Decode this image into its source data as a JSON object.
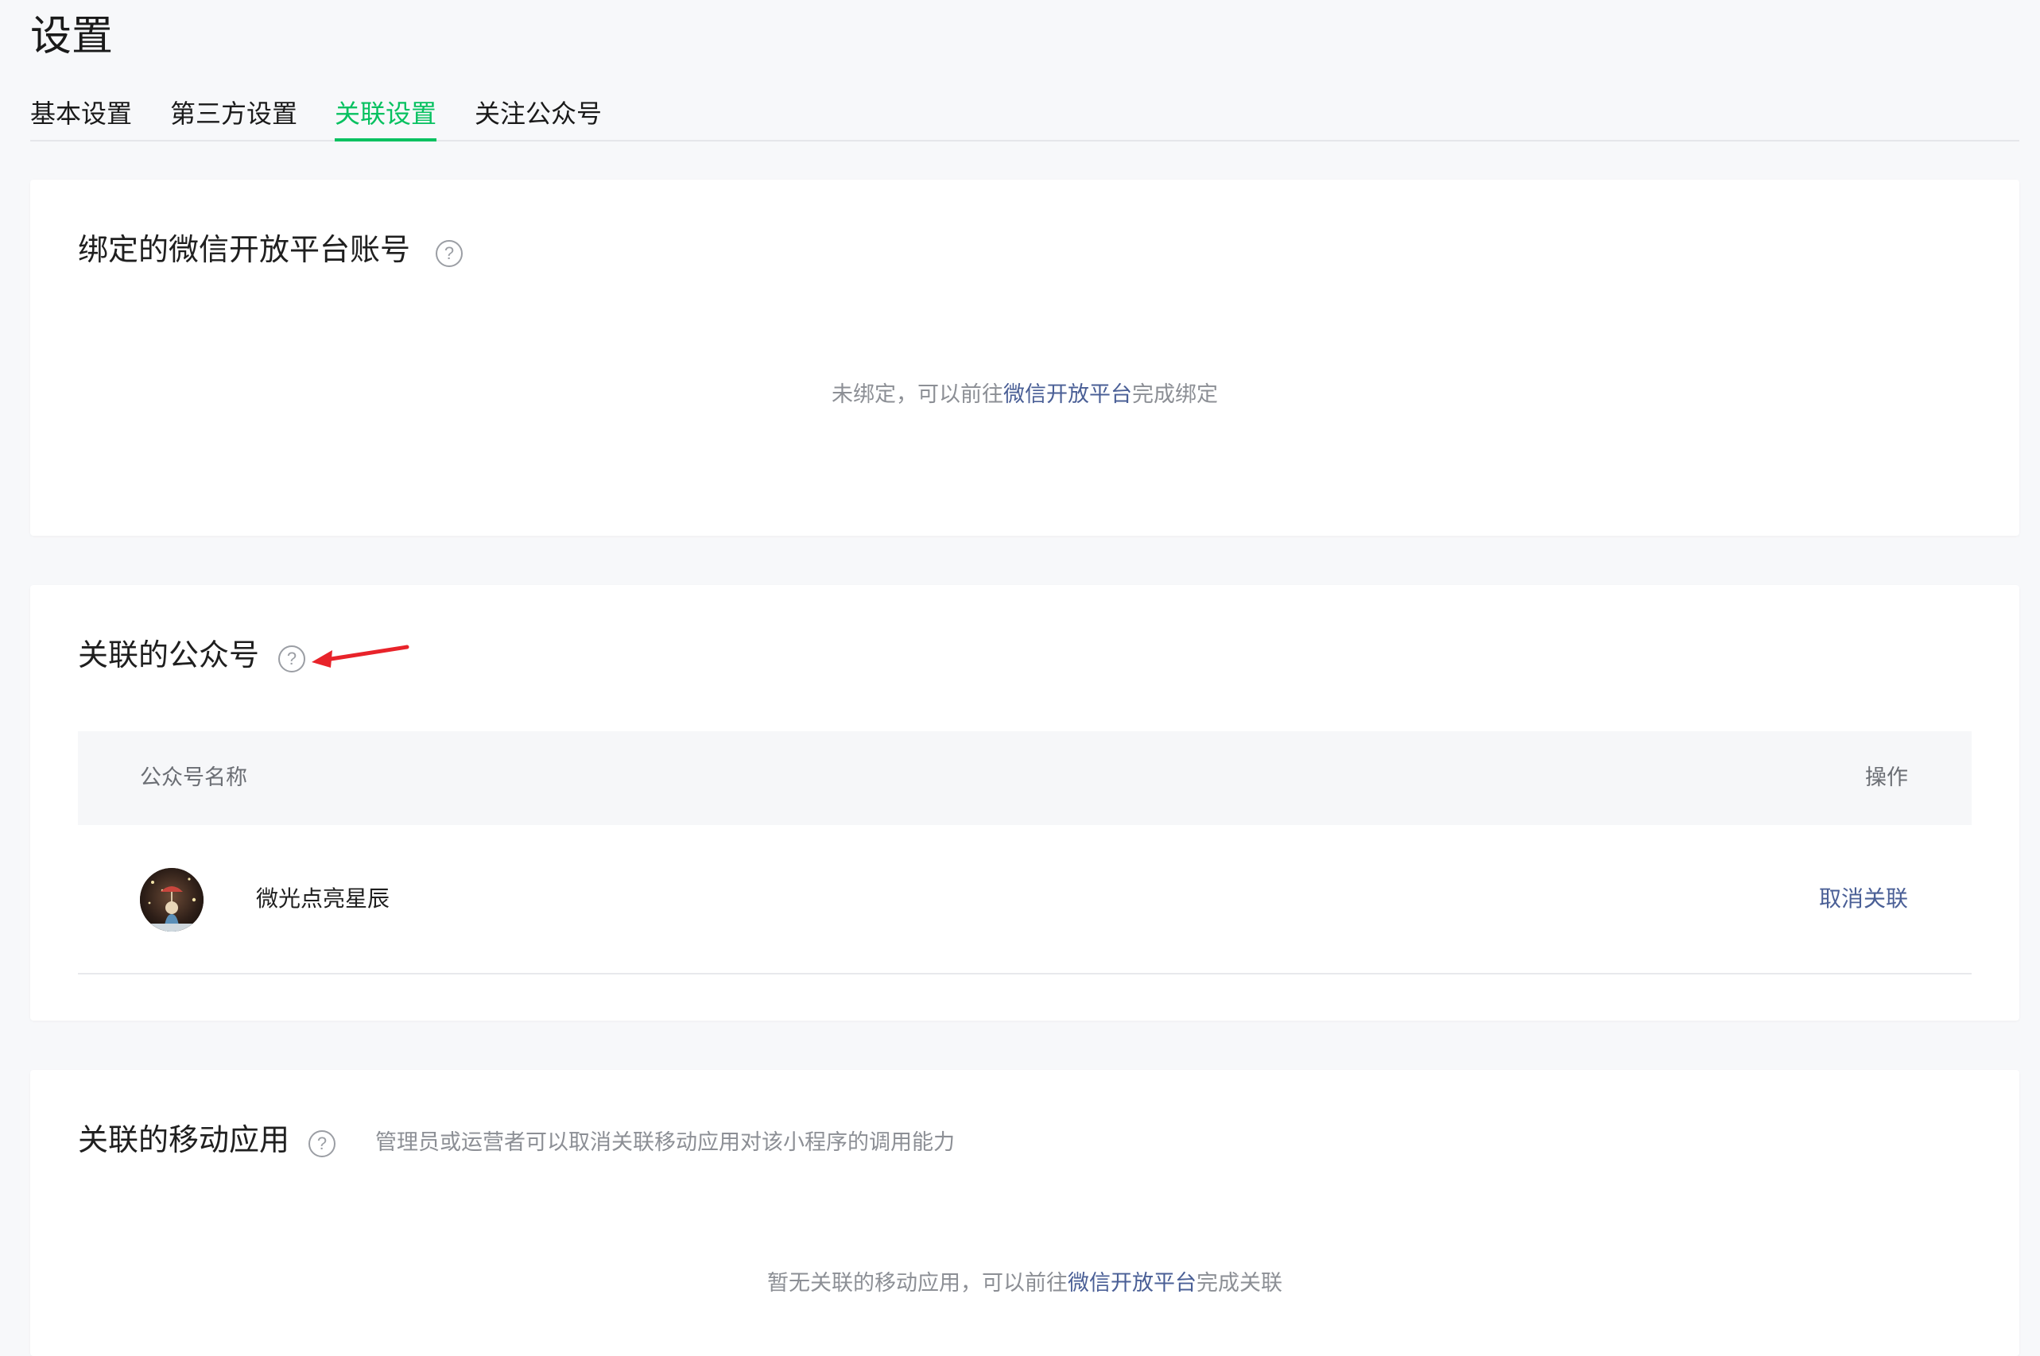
{
  "page": {
    "title": "设置"
  },
  "tabs": [
    {
      "label": "基本设置",
      "active": false
    },
    {
      "label": "第三方设置",
      "active": false
    },
    {
      "label": "关联设置",
      "active": true
    },
    {
      "label": "关注公众号",
      "active": false
    }
  ],
  "colors": {
    "accent": "#07c160",
    "link": "#4a5f96",
    "annotation_arrow": "#e8232a"
  },
  "open_platform": {
    "title": "绑定的微信开放平台账号",
    "help_icon": "question-circle-icon",
    "empty_prefix": "未绑定，可以前往",
    "empty_link": "微信开放平台",
    "empty_suffix": "完成绑定"
  },
  "official_accounts": {
    "title": "关联的公众号",
    "help_icon": "question-circle-icon",
    "table": {
      "columns": [
        "公众号名称",
        "操作"
      ],
      "rows": [
        {
          "avatar": "avatar-image",
          "name": "微光点亮星辰",
          "action": "取消关联"
        }
      ]
    }
  },
  "mobile_apps": {
    "title": "关联的移动应用",
    "help_icon": "question-circle-icon",
    "description": "管理员或运营者可以取消关联移动应用对该小程序的调用能力",
    "empty_prefix": "暂无关联的移动应用，可以前往",
    "empty_link": "微信开放平台",
    "empty_suffix": "完成关联"
  }
}
